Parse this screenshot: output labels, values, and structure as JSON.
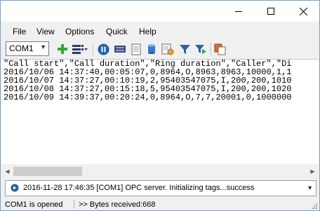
{
  "menu": {
    "items": [
      "File",
      "View",
      "Options",
      "Quick",
      "Help"
    ]
  },
  "toolbar": {
    "port_value": "COM1",
    "icons": [
      "add-icon",
      "columns-icon",
      "pause-icon",
      "device-icon",
      "document-icon",
      "database-icon",
      "schedule-icon",
      "filter-icon",
      "filter-apply-icon",
      "copy-icon"
    ]
  },
  "data_view": {
    "lines": [
      "\"Call start\",\"Call duration\",\"Ring duration\",\"Caller\",\"Di",
      "2016/10/06 14:37:40,00:05:07,0,8964,O,8963,8963,10000,1,1",
      "2016/10/07 14:37:27,00:10:19,2,95403547075,I,200,200,1010",
      "2016/10/08 14:37:27,00:15:18,5,95403547075,I,200,200,1020",
      "2016/10/09 14:39:37,00:20:24,0,8964,O,7,7,20001,0,1000000"
    ]
  },
  "log": {
    "message": "2016-11-28 17:46:35 [COM1] OPC server. Initializing tags...success"
  },
  "status": {
    "port_state": "COM1 is opened",
    "bytes": ">> Bytes received:668"
  },
  "colors": {
    "accent_blue": "#1a5fb4",
    "add_green": "#2ea82e",
    "window_border": "#7a9fc6"
  }
}
